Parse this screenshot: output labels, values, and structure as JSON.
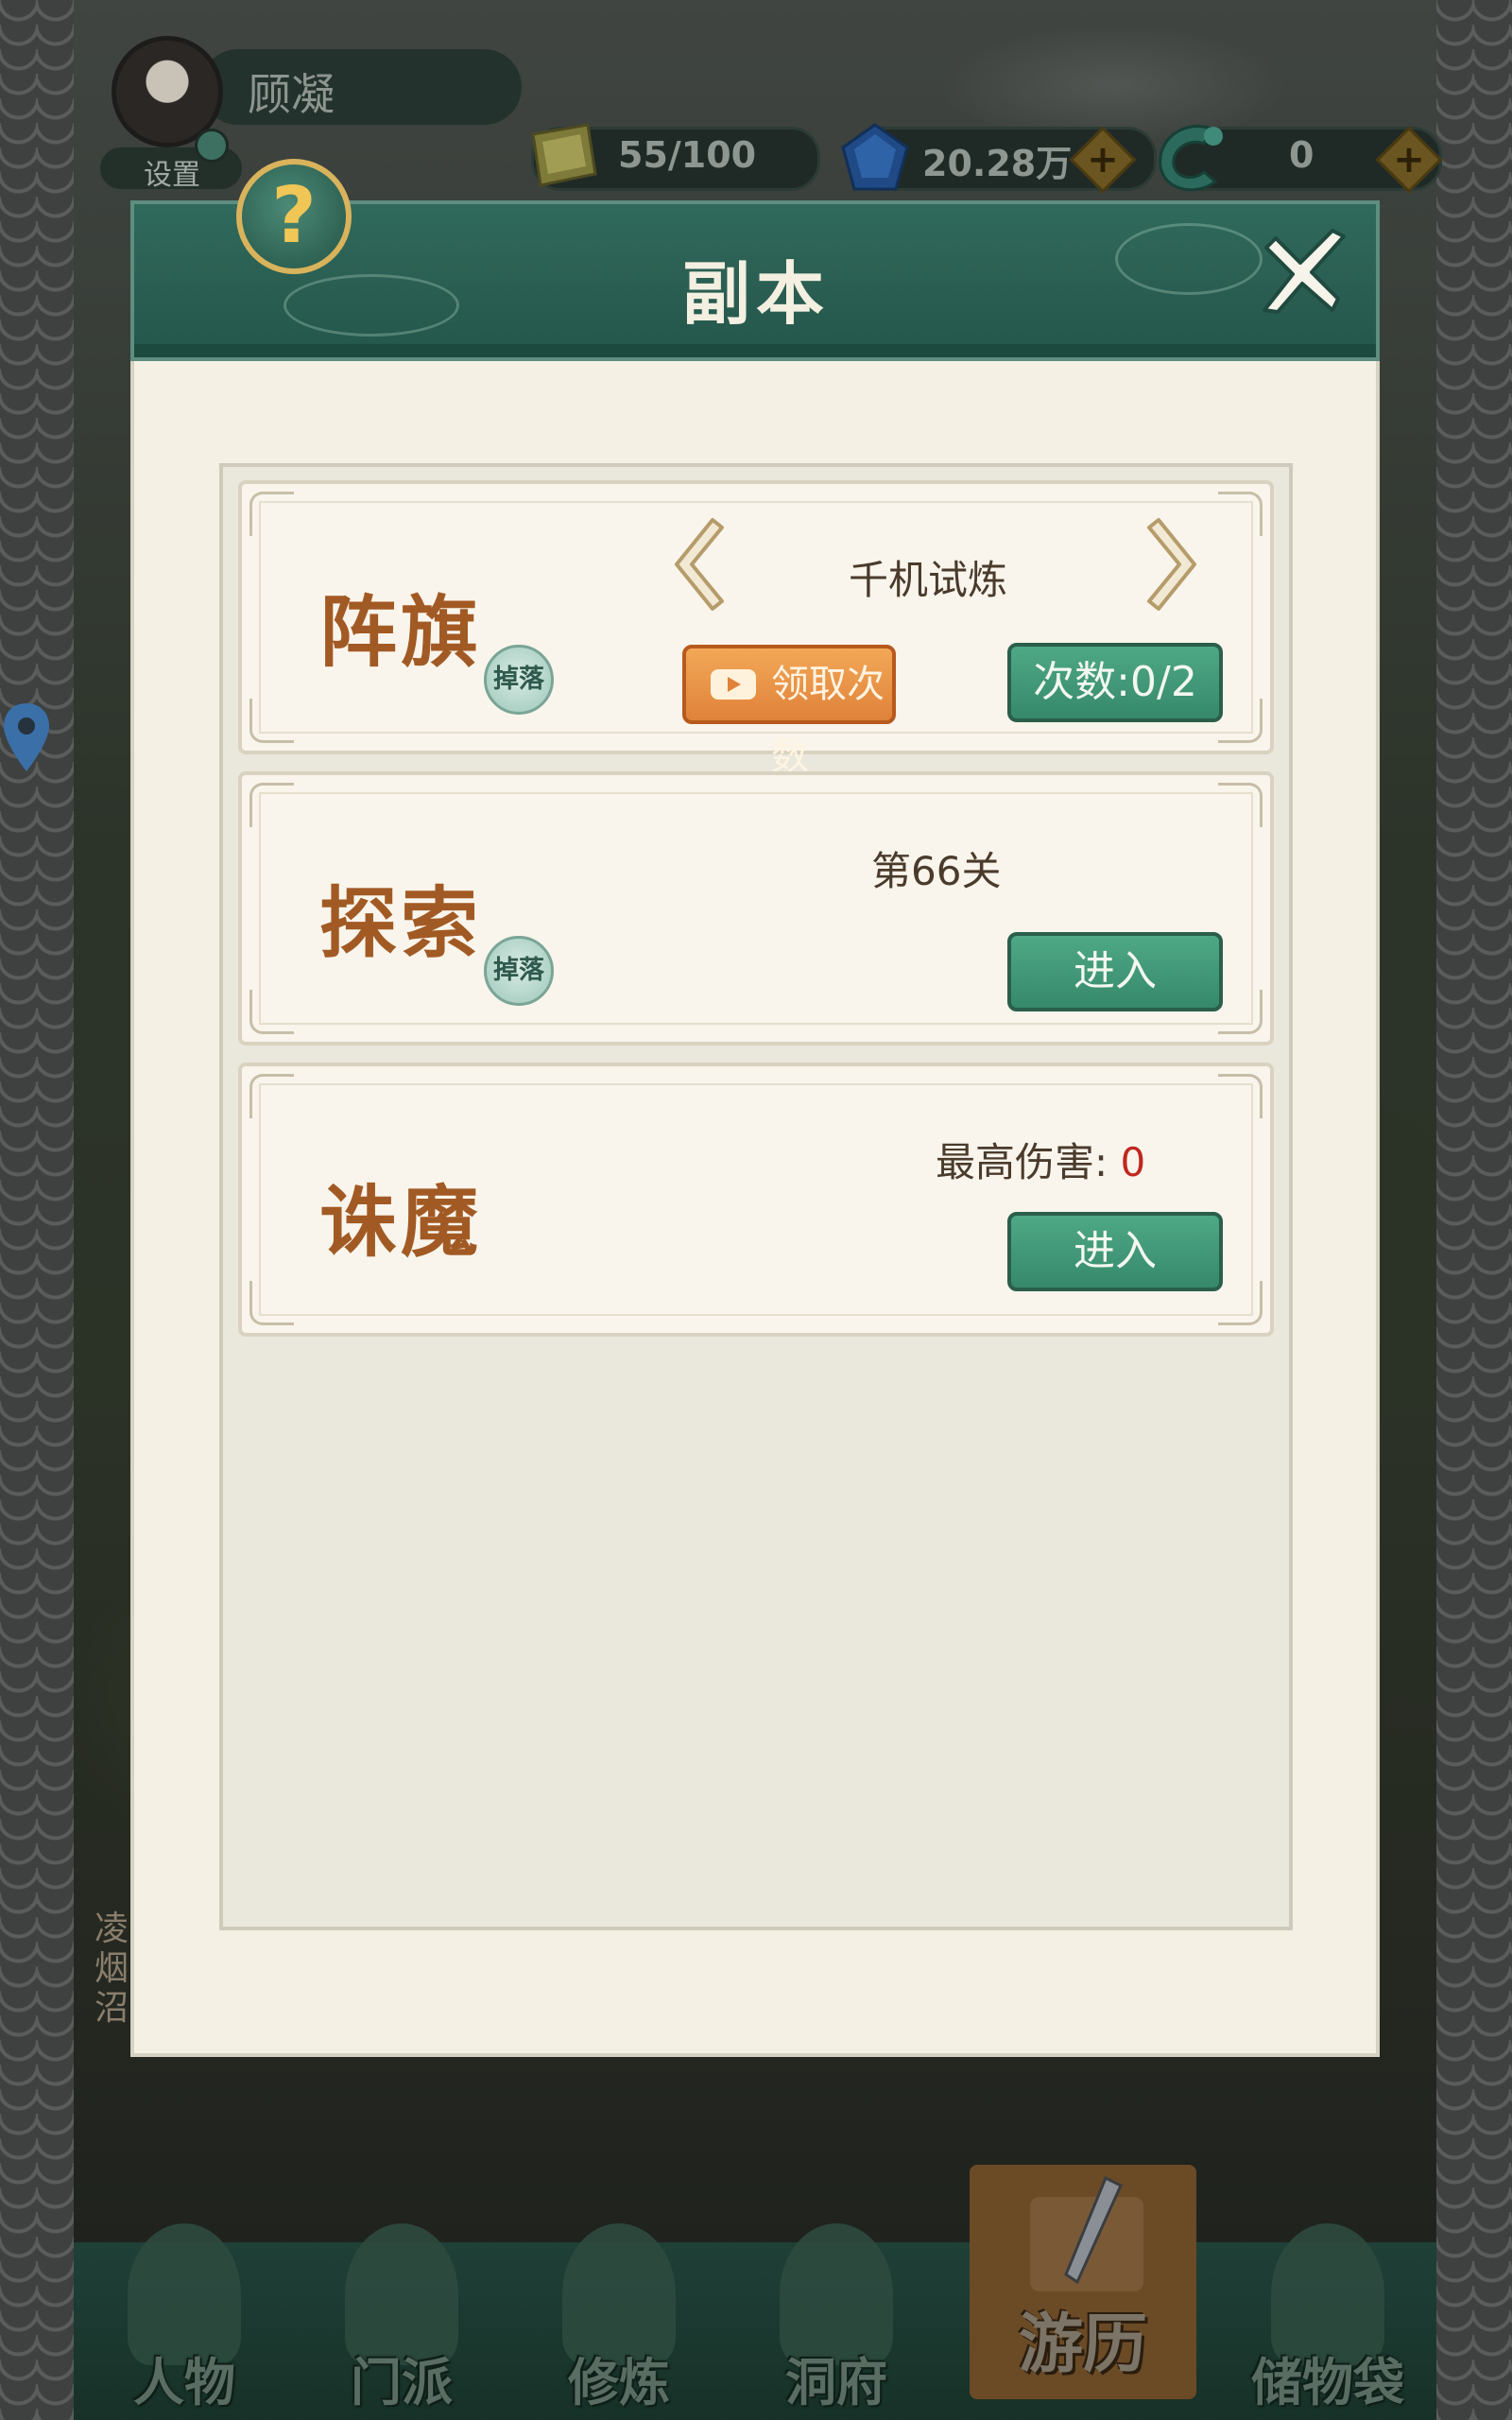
{
  "player": {
    "name": "顾凝",
    "settings_label": "设置"
  },
  "resources": {
    "stamina": "55/100",
    "spirit_stones": "20.28万",
    "jade": "0"
  },
  "dialog": {
    "title": "副本"
  },
  "cards": [
    {
      "title": "阵旗",
      "drop_badge": "掉落",
      "stage_name": "千机试炼",
      "claim_button": "领取次数",
      "count_button": "次数:0/2"
    },
    {
      "title": "探索",
      "drop_badge": "掉落",
      "stage_label": "第66关",
      "enter_button": "进入"
    },
    {
      "title": "诛魔",
      "damage_label": "最高伤害:",
      "damage_value": "0",
      "enter_button": "进入"
    }
  ],
  "map_side_label": "凌烟沼",
  "bottom_nav": {
    "items": [
      "人物",
      "门派",
      "修炼",
      "洞府",
      "游历",
      "储物袋"
    ],
    "active": "游历"
  },
  "colors": {
    "header_green": "#2f6a5c",
    "card_title_brown": "#a25a24",
    "button_green": "#4ea886",
    "button_orange": "#e0823a",
    "damage_red": "#c0271f",
    "gold_accent": "#d9b35c"
  }
}
